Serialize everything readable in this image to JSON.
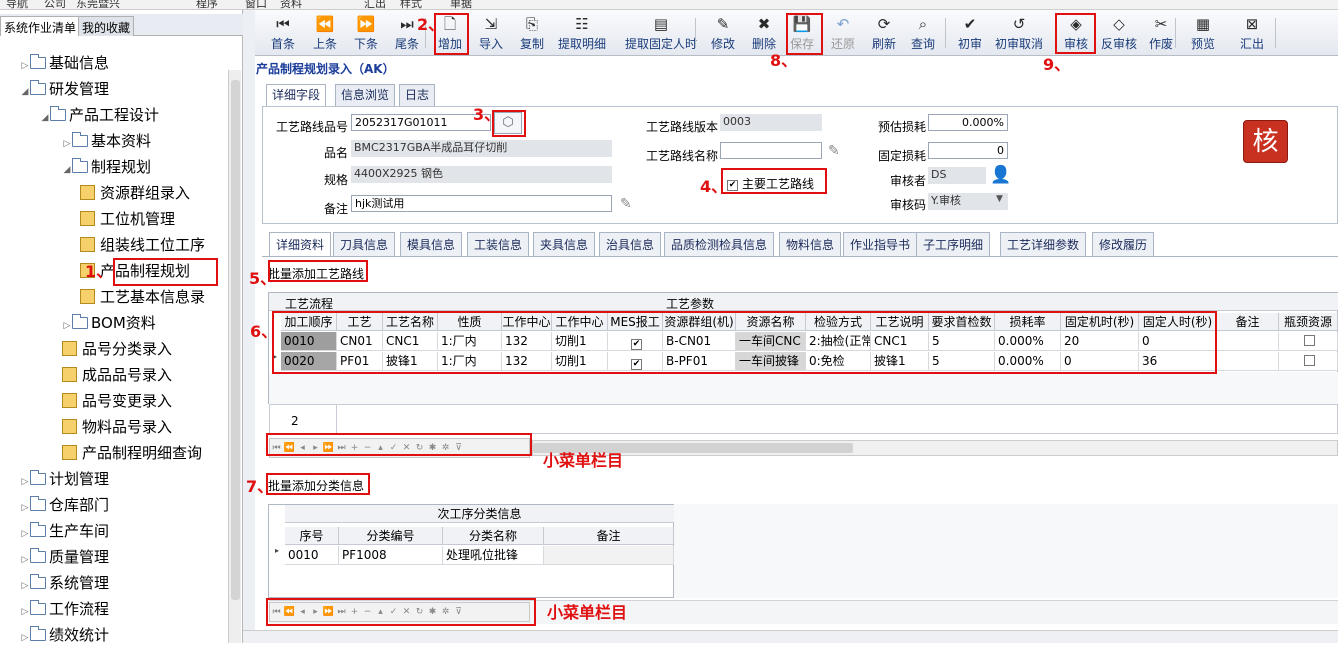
{
  "top_strip": {
    "items": [
      "导航",
      "公司",
      "东莞暨兴",
      "程序",
      "窗口",
      "资料",
      "汇出",
      "样式",
      "单据"
    ]
  },
  "left": {
    "tabs": [
      "系统作业清单",
      "我的收藏"
    ],
    "tree": [
      {
        "label": "基础信息",
        "type": "folder",
        "toggle": "▷"
      },
      {
        "label": "研发管理",
        "type": "folder",
        "toggle": "◢"
      },
      {
        "label": "产品工程设计",
        "type": "folder",
        "toggle": "◢"
      },
      {
        "label": "基本资料",
        "type": "folder",
        "toggle": "▷"
      },
      {
        "label": "制程规划",
        "type": "folder",
        "toggle": "◢"
      },
      {
        "label": "资源群组录入",
        "type": "doc"
      },
      {
        "label": "工位机管理",
        "type": "doc"
      },
      {
        "label": "组装线工位工序",
        "type": "doc"
      },
      {
        "label": "产品制程规划",
        "type": "doc"
      },
      {
        "label": "工艺基本信息录",
        "type": "doc"
      },
      {
        "label": "BOM资料",
        "type": "folder",
        "toggle": "▷"
      },
      {
        "label": "品号分类录入",
        "type": "doc"
      },
      {
        "label": "成品品号录入",
        "type": "doc"
      },
      {
        "label": "品号变更录入",
        "type": "doc"
      },
      {
        "label": "物料品号录入",
        "type": "doc"
      },
      {
        "label": "产品制程明细查询",
        "type": "doc"
      },
      {
        "label": "计划管理",
        "type": "folder",
        "toggle": "▷"
      },
      {
        "label": "仓库部门",
        "type": "folder",
        "toggle": "▷"
      },
      {
        "label": "生产车间",
        "type": "folder",
        "toggle": "▷"
      },
      {
        "label": "质量管理",
        "type": "folder",
        "toggle": "▷"
      },
      {
        "label": "系统管理",
        "type": "folder",
        "toggle": "▷"
      },
      {
        "label": "工作流程",
        "type": "folder",
        "toggle": "▷"
      },
      {
        "label": "绩效统计",
        "type": "folder",
        "toggle": "▷"
      }
    ]
  },
  "toolbar": {
    "buttons": [
      {
        "label": "首条",
        "icon": "⏮",
        "enabled": true
      },
      {
        "label": "上条",
        "icon": "⏪",
        "enabled": true
      },
      {
        "label": "下条",
        "icon": "⏩",
        "enabled": true
      },
      {
        "label": "尾条",
        "icon": "⏭",
        "enabled": true
      },
      {
        "label": "增加",
        "icon": "🗋",
        "enabled": true
      },
      {
        "label": "导入",
        "icon": "⇲",
        "enabled": true
      },
      {
        "label": "复制",
        "icon": "⎘",
        "enabled": true
      },
      {
        "label": "提取明细",
        "icon": "☷",
        "enabled": true
      },
      {
        "label": "提取固定人时",
        "icon": "▤",
        "enabled": true
      },
      {
        "label": "修改",
        "icon": "✎",
        "enabled": true
      },
      {
        "label": "删除",
        "icon": "✖",
        "enabled": true
      },
      {
        "label": "保存",
        "icon": "💾",
        "enabled": false
      },
      {
        "label": "还原",
        "icon": "↶",
        "enabled": false
      },
      {
        "label": "刷新",
        "icon": "⟳",
        "enabled": true
      },
      {
        "label": "查询",
        "icon": "⌕",
        "enabled": true
      },
      {
        "label": "初审",
        "icon": "✔",
        "enabled": true
      },
      {
        "label": "初审取消",
        "icon": "↺",
        "enabled": true
      },
      {
        "label": "审核",
        "icon": "◈",
        "enabled": true
      },
      {
        "label": "反审核",
        "icon": "◇",
        "enabled": true
      },
      {
        "label": "作废",
        "icon": "✂",
        "enabled": true
      },
      {
        "label": "预览",
        "icon": "▦",
        "enabled": true
      },
      {
        "label": "汇出",
        "icon": "⊠",
        "enabled": true
      }
    ]
  },
  "form": {
    "title": "产品制程规划录入（AK）",
    "tabs": [
      "详细字段",
      "信息浏览",
      "日志"
    ],
    "route_no": {
      "label": "工艺路线品号",
      "value": "2052317G01011"
    },
    "name": {
      "label": "品名",
      "value": "BMC2317GBA半成品耳仔切削"
    },
    "spec": {
      "label": "规格",
      "value": "4400X2925 钢色"
    },
    "remark": {
      "label": "备注",
      "value": "hjk测试用"
    },
    "route_version": {
      "label": "工艺路线版本",
      "value": "0003"
    },
    "route_name": {
      "label": "工艺路线名称",
      "value": ""
    },
    "main_route": {
      "label": "主要工艺路线",
      "checked": "✔"
    },
    "est_loss": {
      "label": "预估损耗",
      "value": "0.000%"
    },
    "fixed_loss": {
      "label": "固定损耗",
      "value": "0"
    },
    "reviewer": {
      "label": "审核者",
      "value": "DS"
    },
    "review_code": {
      "label": "审核码",
      "value": "Y.审核"
    },
    "approve_badge": "核"
  },
  "detail_tabs": [
    "详细资料",
    "刀具信息",
    "模具信息",
    "工装信息",
    "夹具信息",
    "治具信息",
    "品质检测检具信息",
    "物料信息",
    "作业指导书",
    "子工序明细",
    "工艺详细参数",
    "修改履历"
  ],
  "process": {
    "section_label": "批量添加工艺路线",
    "group_headers": [
      "工艺流程",
      "工艺参数"
    ],
    "columns": [
      "加工顺序",
      "工艺",
      "工艺名称",
      "性质",
      "工作中心",
      "工作中心",
      "MES报工",
      "资源群组(机)",
      "资源名称",
      "检验方式",
      "工艺说明",
      "要求首检数",
      "损耗率",
      "固定机时(秒)",
      "固定人时(秒)",
      "备注",
      "瓶颈资源"
    ],
    "rows": [
      [
        "0010",
        "CN01",
        "CNC1",
        "1:厂内",
        "132",
        "切削1",
        "✔",
        "B-CN01",
        "一车间CNC",
        "2:抽检(正常",
        "CNC1",
        "5",
        "0.000%",
        "20",
        "0",
        "",
        ""
      ],
      [
        "0020",
        "PF01",
        "披锋1",
        "1:厂内",
        "132",
        "切削1",
        "✔",
        "B-PF01",
        "一车间披锋",
        "0:免检",
        "披锋1",
        "5",
        "0.000%",
        "0",
        "36",
        "",
        ""
      ]
    ],
    "row_count": "2"
  },
  "classify": {
    "section_label": "批量添加分类信息",
    "group_header": "次工序分类信息",
    "columns": [
      "序号",
      "分类编号",
      "分类名称",
      "备注"
    ],
    "rows": [
      [
        "0010",
        "PF1008",
        "处理吼位批锋",
        ""
      ]
    ]
  },
  "navbar_icons": [
    "⏮",
    "⏪",
    "◂",
    "▸",
    "⏩",
    "⏭",
    "+",
    "−",
    "▴",
    "✓",
    "✕",
    "↻",
    "✱",
    "✲",
    "⊽"
  ],
  "annotations": {
    "n1": "1、",
    "n2": "2、",
    "n3": "3、",
    "n4": "4、",
    "n5": "5、",
    "n6": "6、",
    "n7": "7、",
    "n8": "8、",
    "n9": "9、",
    "small_menu": "小菜单栏目"
  },
  "colors": {
    "annotation": "#e01010",
    "title": "#1a3c9a",
    "approve": "#c83020"
  }
}
